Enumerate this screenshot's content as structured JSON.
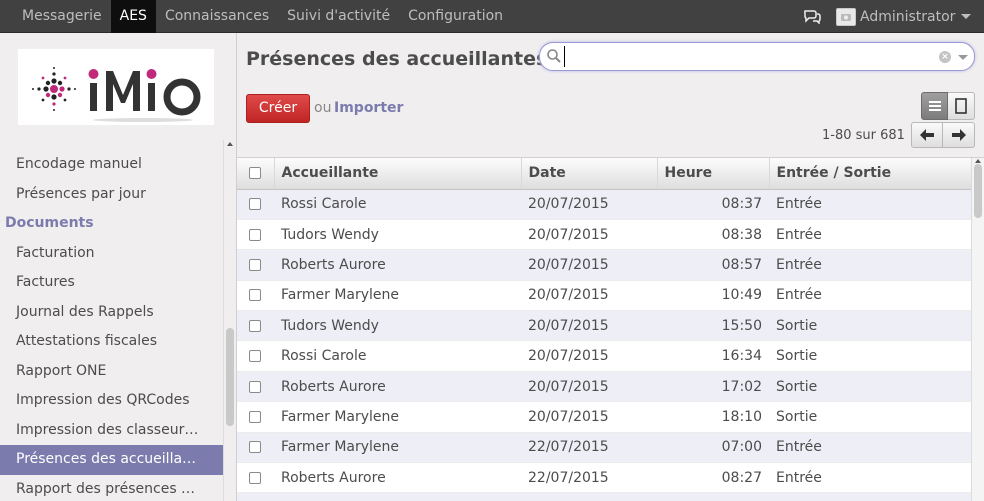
{
  "topbar": {
    "menu": [
      {
        "label": "Messagerie",
        "active": false
      },
      {
        "label": "AES",
        "active": true
      },
      {
        "label": "Connaissances",
        "active": false
      },
      {
        "label": "Suivi d'activité",
        "active": false
      },
      {
        "label": "Configuration",
        "active": false
      }
    ],
    "user_name": "Administrator",
    "chat_icon": "chat-bubbles-icon",
    "avatar_icon": "camera-placeholder-icon"
  },
  "sidebar": {
    "logo_text": "iMio",
    "items": [
      {
        "label": "Encodage manuel",
        "type": "item"
      },
      {
        "label": "Présences par jour",
        "type": "item"
      },
      {
        "label": "Documents",
        "type": "section"
      },
      {
        "label": "Facturation",
        "type": "item"
      },
      {
        "label": "Factures",
        "type": "item"
      },
      {
        "label": "Journal des Rappels",
        "type": "item"
      },
      {
        "label": "Attestations fiscales",
        "type": "item"
      },
      {
        "label": "Rapport ONE",
        "type": "item"
      },
      {
        "label": "Impression des QRCodes",
        "type": "item"
      },
      {
        "label": "Impression des classeur…",
        "type": "item"
      },
      {
        "label": "Présences des accueilla…",
        "type": "item",
        "active": true
      },
      {
        "label": "Rapport des présences …",
        "type": "item"
      }
    ]
  },
  "main": {
    "title": "Présences des accueillantes",
    "search": {
      "value": "",
      "placeholder": ""
    },
    "create_label": "Créer",
    "or_label": "ou",
    "import_label": "Importer",
    "pager": "1-80 sur 681",
    "view_modes": [
      "list-view-icon",
      "form-view-icon"
    ],
    "table": {
      "columns": [
        "Accueillante",
        "Date",
        "Heure",
        "Entrée / Sortie"
      ],
      "rows": [
        {
          "name": "Rossi Carole",
          "date": "20/07/2015",
          "time": "08:37",
          "direction": "Entrée"
        },
        {
          "name": "Tudors Wendy",
          "date": "20/07/2015",
          "time": "08:38",
          "direction": "Entrée"
        },
        {
          "name": "Roberts Aurore",
          "date": "20/07/2015",
          "time": "08:57",
          "direction": "Entrée"
        },
        {
          "name": "Farmer Marylene",
          "date": "20/07/2015",
          "time": "10:49",
          "direction": "Entrée"
        },
        {
          "name": "Tudors Wendy",
          "date": "20/07/2015",
          "time": "15:50",
          "direction": "Sortie"
        },
        {
          "name": "Rossi Carole",
          "date": "20/07/2015",
          "time": "16:34",
          "direction": "Sortie"
        },
        {
          "name": "Roberts Aurore",
          "date": "20/07/2015",
          "time": "17:02",
          "direction": "Sortie"
        },
        {
          "name": "Farmer Marylene",
          "date": "20/07/2015",
          "time": "18:10",
          "direction": "Sortie"
        },
        {
          "name": "Farmer Marylene",
          "date": "22/07/2015",
          "time": "07:00",
          "direction": "Entrée"
        },
        {
          "name": "Roberts Aurore",
          "date": "22/07/2015",
          "time": "08:27",
          "direction": "Entrée"
        },
        {
          "name": "",
          "date": "",
          "time": "",
          "direction": ""
        }
      ]
    }
  },
  "colors": {
    "topbar": "#414141",
    "accent": "#7c7bad",
    "create_button": "#dc3232",
    "sidebar_bg": "#f0eeee",
    "row_alt": "#eeeef6"
  }
}
